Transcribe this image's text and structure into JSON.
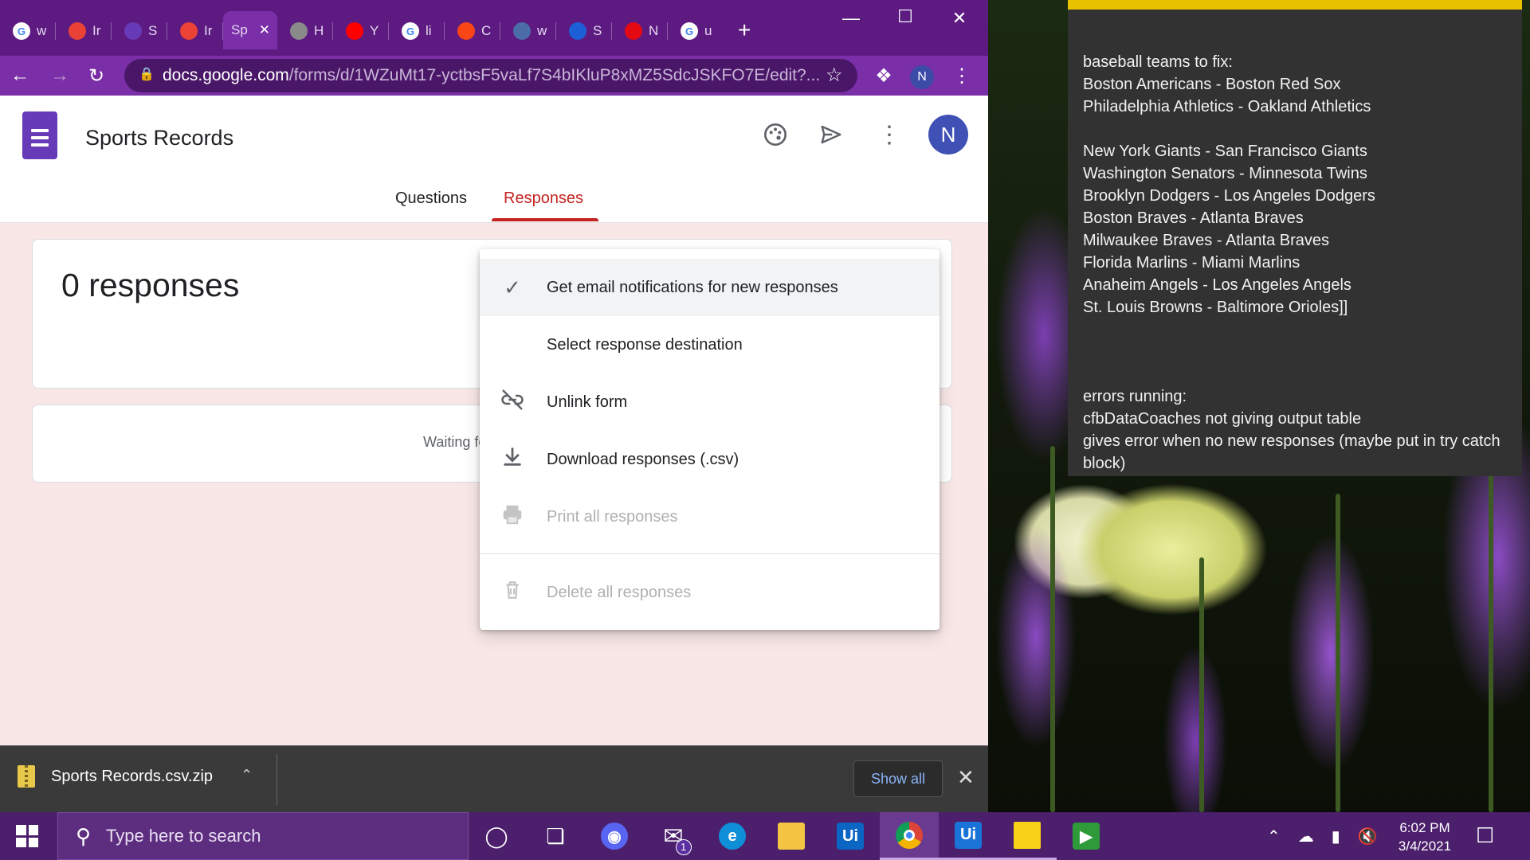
{
  "browser": {
    "tabs": [
      {
        "letter": "w",
        "icon": "google-icon",
        "color": "#ffffff"
      },
      {
        "letter": "Ir",
        "icon": "gmail-icon",
        "color": "#ea4335"
      },
      {
        "letter": "S",
        "icon": "forms-list-icon",
        "color": "#673ab7"
      },
      {
        "letter": "Ir",
        "icon": "gmail-icon",
        "color": "#ea4335"
      },
      {
        "letter": "Sp",
        "icon": "forms-icon",
        "color": "#7a2fa8",
        "active": true
      },
      {
        "letter": "H",
        "icon": "globe-icon",
        "color": "#8a8a8a"
      },
      {
        "letter": "Y",
        "icon": "youtube-icon",
        "color": "#ff0000"
      },
      {
        "letter": "li",
        "icon": "google-icon",
        "color": "#ffffff"
      },
      {
        "letter": "C",
        "icon": "uipath-icon",
        "color": "#fa4616"
      },
      {
        "letter": "w",
        "icon": "clock-app-icon",
        "color": "#4a6da7"
      },
      {
        "letter": "S",
        "icon": "shoe-icon",
        "color": "#1c5fd6"
      },
      {
        "letter": "N",
        "icon": "netflix-icon",
        "color": "#e50914"
      },
      {
        "letter": "u",
        "icon": "google-icon",
        "color": "#ffffff"
      }
    ],
    "new_tab": "+",
    "url_host": "docs.google.com",
    "url_path": "/forms/d/1WZuMt17-yctbsF5vaLf7S4bIKluP8xMZ5SdcJSKFO7E/edit?...",
    "profile_initial": "N"
  },
  "form": {
    "title": "Sports Records",
    "avatar_initial": "N",
    "tabs": {
      "questions": "Questions",
      "responses": "Responses"
    },
    "responses_count": "0 responses",
    "waiting": "Waiting fo"
  },
  "menu": {
    "items": [
      {
        "label": "Get email notifications for new responses",
        "icon": "check-icon",
        "selected": true,
        "disabled": false
      },
      {
        "label": "Select response destination",
        "icon": "",
        "selected": false,
        "disabled": false
      },
      {
        "label": "Unlink form",
        "icon": "link-off-icon",
        "selected": false,
        "disabled": false
      },
      {
        "label": "Download responses (.csv)",
        "icon": "download-icon",
        "selected": false,
        "disabled": false
      },
      {
        "label": "Print all responses",
        "icon": "print-icon",
        "selected": false,
        "disabled": true
      },
      {
        "label": "Delete all responses",
        "icon": "trash-icon",
        "selected": false,
        "disabled": true
      }
    ]
  },
  "downloads": {
    "file": "Sports Records.csv.zip",
    "show_all": "Show all"
  },
  "sticky": {
    "text": "baseball teams to fix:\nBoston Americans - Boston Red Sox\nPhiladelphia Athletics - Oakland Athletics\n\nNew York Giants - San Francisco Giants\nWashington Senators - Minnesota Twins\nBrooklyn Dodgers - Los Angeles Dodgers\nBoston Braves - Atlanta Braves\nMilwaukee Braves - Atlanta Braves\nFlorida Marlins - Miami Marlins\nAnaheim Angels - Los Angeles Angels\nSt. Louis Browns - Baltimore Orioles]]\n\n\n\nerrors running:\ncfbDataCoaches not giving output table\ngives error when no new responses (maybe put in try catch block)"
  },
  "taskbar": {
    "search_placeholder": "Type here to search",
    "mail_badge": "1",
    "time": "6:02 PM",
    "date": "3/4/2021"
  }
}
